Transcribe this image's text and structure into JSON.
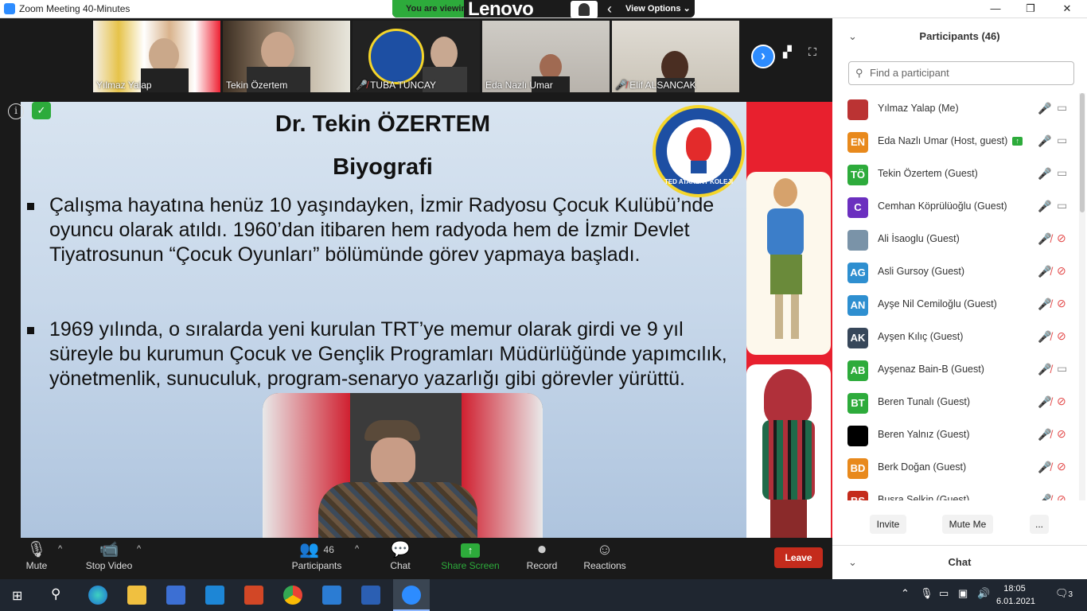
{
  "window": {
    "title": "Zoom Meeting 40-Minutes",
    "min": "—",
    "restore": "❐",
    "close": "✕"
  },
  "banner": {
    "viewing_text": "You are viewing",
    "lenovo": "Lenovo",
    "view_options": "View Options ⌄"
  },
  "gallery": {
    "tiles": [
      {
        "name": "Yılmaz Yalap",
        "muted": false
      },
      {
        "name": "Tekin Özertem",
        "muted": false
      },
      {
        "name": "TUBA TUNCAY",
        "muted": true
      },
      {
        "name": "Eda Nazlı Umar",
        "muted": false
      },
      {
        "name": "Elif ALSANCAK",
        "muted": true
      }
    ],
    "next_icon": "›"
  },
  "slide": {
    "title": "Dr. Tekin ÖZERTEM",
    "subtitle": "Biyografi",
    "bullets": [
      "Çalışma hayatına henüz 10 yaşındayken, İzmir Radyosu Çocuk Kulübü’nde oyuncu olarak atıldı. 1960’dan itibaren hem radyoda hem de İzmir Devlet Tiyatrosunun “Çocuk Oyunları” bölümünde görev yapmaya başladı.",
      "1969 yılında, o sıralarda yeni kurulan TRT’ye memur olarak girdi ve 9 yıl süreyle bu kurumun Çocuk ve Gençlik Programları Müdürlüğünde yapımcılık, yönetmenlik, sunuculuk, program-senaryo yazarlığı gibi görevler yürüttü."
    ],
    "emblem_text": "TED ATAKENT KOLEJİ"
  },
  "toolbar": {
    "mute": "Mute",
    "stop_video": "Stop Video",
    "participants": "Participants",
    "participants_count": "46",
    "chat": "Chat",
    "share_screen": "Share Screen",
    "record": "Record",
    "reactions": "Reactions",
    "leave": "Leave",
    "colors": {
      "share": "#2dab3b",
      "leave": "#c42b1c"
    }
  },
  "panel": {
    "title": "Participants (46)",
    "search_placeholder": "Find a participant",
    "participants": [
      {
        "initials": "",
        "name": "Yılmaz Yalap (Me)",
        "color": "#b33",
        "mic": "on",
        "cam": "on",
        "sharing": false
      },
      {
        "initials": "EN",
        "name": "Eda Nazlı Umar (Host, guest)",
        "color": "#e8891c",
        "mic": "on",
        "cam": "on",
        "sharing": true
      },
      {
        "initials": "TÖ",
        "name": "Tekin Özertem (Guest)",
        "color": "#2dab3b",
        "mic": "on",
        "cam": "on",
        "sharing": false
      },
      {
        "initials": "C",
        "name": "Cemhan Köprülüoğlu (Guest)",
        "color": "#6b2fbf",
        "mic": "on",
        "cam": "on",
        "sharing": false
      },
      {
        "initials": "",
        "name": "Ali İsaoglu (Guest)",
        "color": "#7a93a8",
        "mic": "off",
        "cam": "off",
        "sharing": false
      },
      {
        "initials": "AG",
        "name": "Asli Gursoy (Guest)",
        "color": "#2e8fd0",
        "mic": "off",
        "cam": "off",
        "sharing": false
      },
      {
        "initials": "AN",
        "name": "Ayşe Nil Cemiloğlu (Guest)",
        "color": "#2e8fd0",
        "mic": "off",
        "cam": "off",
        "sharing": false
      },
      {
        "initials": "AK",
        "name": "Ayşen Kılıç (Guest)",
        "color": "#37475a",
        "mic": "off",
        "cam": "off",
        "sharing": false
      },
      {
        "initials": "AB",
        "name": "Ayşenaz Bain-B (Guest)",
        "color": "#2dab3b",
        "mic": "off",
        "cam": "on",
        "sharing": false
      },
      {
        "initials": "BT",
        "name": "Beren Tunalı (Guest)",
        "color": "#2dab3b",
        "mic": "off",
        "cam": "off",
        "sharing": false
      },
      {
        "initials": "",
        "name": "Beren Yalnız (Guest)",
        "color": "#000000",
        "mic": "off",
        "cam": "off",
        "sharing": false
      },
      {
        "initials": "BD",
        "name": "Berk Doğan (Guest)",
        "color": "#e8891c",
        "mic": "off",
        "cam": "off",
        "sharing": false
      },
      {
        "initials": "BS",
        "name": "Buşra Selkin (Guest)",
        "color": "#c42b1c",
        "mic": "off",
        "cam": "off",
        "sharing": false
      }
    ],
    "invite": "Invite",
    "mute_me": "Mute Me",
    "more": "...",
    "chat_title": "Chat"
  },
  "taskbar": {
    "time": "18:05",
    "date": "6.01.2021",
    "notif_count": "3"
  }
}
